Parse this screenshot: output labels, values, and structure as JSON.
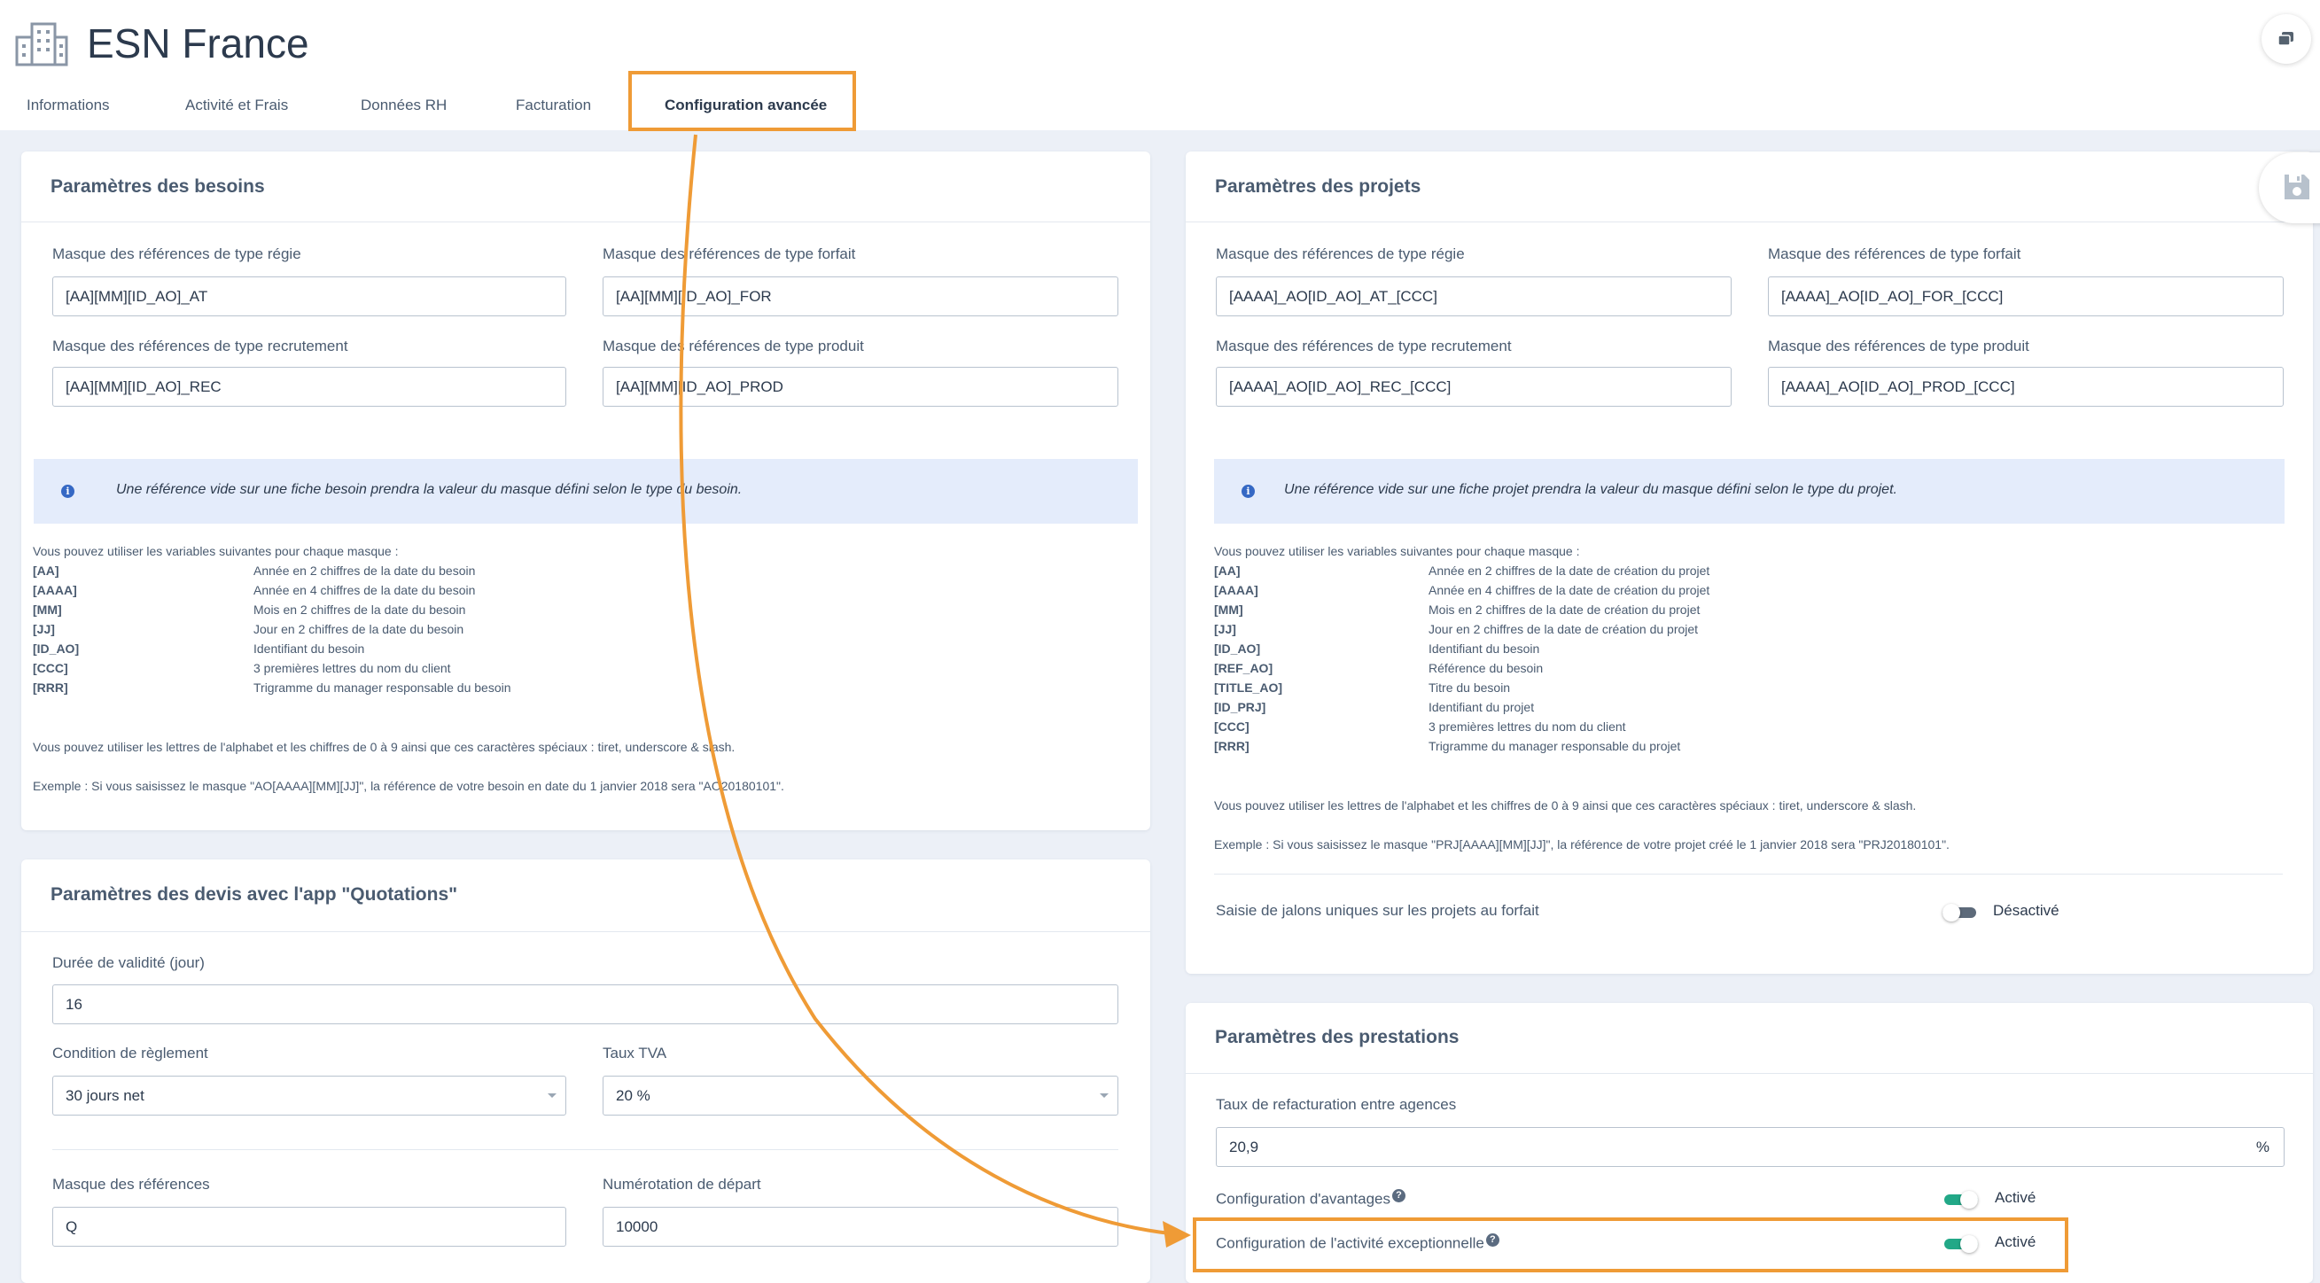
{
  "header": {
    "title": "ESN France"
  },
  "tabs": [
    {
      "label": "Informations"
    },
    {
      "label": "Activité et Frais"
    },
    {
      "label": "Données RH"
    },
    {
      "label": "Facturation"
    },
    {
      "label": "Configuration avancée"
    }
  ],
  "besoins": {
    "title": "Paramètres des besoins",
    "regie_label": "Masque des références de type régie",
    "regie_value": "[AA][MM][ID_AO]_AT",
    "forfait_label": "Masque des références de type forfait",
    "forfait_value": "[AA][MM][ID_AO]_FOR",
    "recrutement_label": "Masque des références de type recrutement",
    "recrutement_value": "[AA][MM][ID_AO]_REC",
    "produit_label": "Masque des références de type produit",
    "produit_value": "[AA][MM][ID_AO]_PROD",
    "info": "Une référence vide sur une fiche besoin prendra la valeur du masque défini selon le type du besoin.",
    "vars_intro": "Vous pouvez utiliser les variables suivantes pour chaque masque :",
    "vars": [
      {
        "code": "[AA]",
        "desc": "Année en 2 chiffres de la date du besoin"
      },
      {
        "code": "[AAAA]",
        "desc": "Année en 4 chiffres de la date du besoin"
      },
      {
        "code": "[MM]",
        "desc": "Mois en 2 chiffres de la date du besoin"
      },
      {
        "code": "[JJ]",
        "desc": "Jour en 2 chiffres de la date du besoin"
      },
      {
        "code": "[ID_AO]",
        "desc": "Identifiant du besoin"
      },
      {
        "code": "[CCC]",
        "desc": "3 premières lettres du nom du client"
      },
      {
        "code": "[RRR]",
        "desc": "Trigramme du manager responsable du besoin"
      }
    ],
    "note_chars": "Vous pouvez utiliser les lettres de l'alphabet et les chiffres de 0 à 9 ainsi que ces caractères spéciaux : tiret, underscore & slash.",
    "note_example": "Exemple : Si vous saisissez le masque \"AO[AAAA][MM][JJ]\", la référence de votre besoin en date du 1 janvier 2018 sera \"AO20180101\"."
  },
  "devis": {
    "title": "Paramètres des devis avec l'app \"Quotations\"",
    "validite_label": "Durée de validité (jour)",
    "validite_value": "16",
    "reglement_label": "Condition de règlement",
    "reglement_value": "30 jours net",
    "tva_label": "Taux TVA",
    "tva_value": "20 %",
    "masque_label": "Masque des références",
    "masque_value": "Q",
    "numerotation_label": "Numérotation de départ",
    "numerotation_value": "10000"
  },
  "projets": {
    "title": "Paramètres des projets",
    "regie_label": "Masque des références de type régie",
    "regie_value": "[AAAA]_AO[ID_AO]_AT_[CCC]",
    "forfait_label": "Masque des références de type forfait",
    "forfait_value": "[AAAA]_AO[ID_AO]_FOR_[CCC]",
    "recrutement_label": "Masque des références de type recrutement",
    "recrutement_value": "[AAAA]_AO[ID_AO]_REC_[CCC]",
    "produit_label": "Masque des références de type produit",
    "produit_value": "[AAAA]_AO[ID_AO]_PROD_[CCC]",
    "info": "Une référence vide sur une fiche projet prendra la valeur du masque défini selon le type du projet.",
    "vars_intro": "Vous pouvez utiliser les variables suivantes pour chaque masque :",
    "vars": [
      {
        "code": "[AA]",
        "desc": "Année en 2 chiffres de la date de création du projet"
      },
      {
        "code": "[AAAA]",
        "desc": "Année en 4 chiffres de la date de création du projet"
      },
      {
        "code": "[MM]",
        "desc": "Mois en 2 chiffres de la date de création du projet"
      },
      {
        "code": "[JJ]",
        "desc": "Jour en 2 chiffres de la date de création du projet"
      },
      {
        "code": "[ID_AO]",
        "desc": "Identifiant du besoin"
      },
      {
        "code": "[REF_AO]",
        "desc": "Référence du besoin"
      },
      {
        "code": "[TITLE_AO]",
        "desc": "Titre du besoin"
      },
      {
        "code": "[ID_PRJ]",
        "desc": "Identifiant du projet"
      },
      {
        "code": "[CCC]",
        "desc": "3 premières lettres du nom du client"
      },
      {
        "code": "[RRR]",
        "desc": "Trigramme du manager responsable du projet"
      }
    ],
    "note_chars": "Vous pouvez utiliser les lettres de l'alphabet et les chiffres de 0 à 9 ainsi que ces caractères spéciaux : tiret, underscore & slash.",
    "note_example": "Exemple : Si vous saisissez le masque \"PRJ[AAAA][MM][JJ]\", la référence de votre projet créé le 1 janvier 2018 sera \"PRJ20180101\".",
    "jalons_label": "Saisie de jalons uniques sur les projets au forfait",
    "jalons_state": "Désactivé"
  },
  "prestations": {
    "title": "Paramètres des prestations",
    "taux_label": "Taux de refacturation entre agences",
    "taux_value": "20,9",
    "taux_unit": "%",
    "avantages_label": "Configuration d'avantages",
    "avantages_state": "Activé",
    "exceptionnelle_label": "Configuration de l'activité exceptionnelle",
    "exceptionnelle_state": "Activé"
  },
  "colors": {
    "accent": "#ef9b36",
    "toggle_on": "#22a887",
    "info_bg": "#e4ecfb",
    "info_icon": "#3568c4"
  }
}
